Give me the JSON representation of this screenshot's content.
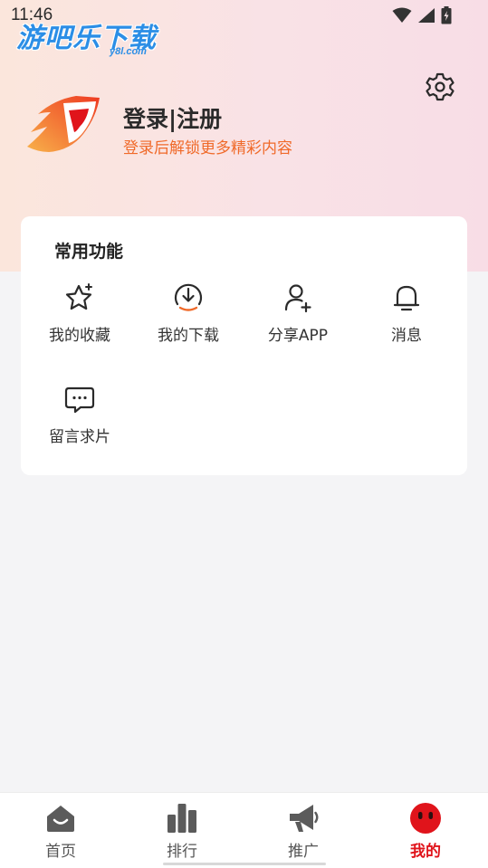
{
  "status_bar": {
    "time": "11:46"
  },
  "watermark": {
    "brand": "游吧乐下载",
    "domain": "y8l.com"
  },
  "profile": {
    "login_label": "登录|注册",
    "subtitle": "登录后解锁更多精彩内容"
  },
  "features": {
    "title": "常用功能",
    "items": [
      {
        "label": "我的收藏",
        "icon": "star-icon"
      },
      {
        "label": "我的下载",
        "icon": "download-icon"
      },
      {
        "label": "分享APP",
        "icon": "add-user-icon"
      },
      {
        "label": "消息",
        "icon": "bell-icon"
      },
      {
        "label": "留言求片",
        "icon": "message-icon"
      }
    ]
  },
  "bottom_nav": {
    "items": [
      {
        "label": "首页",
        "icon": "home-icon"
      },
      {
        "label": "排行",
        "icon": "ranking-icon"
      },
      {
        "label": "推广",
        "icon": "megaphone-icon"
      },
      {
        "label": "我的",
        "icon": "profile-face-icon",
        "active": true
      }
    ]
  },
  "colors": {
    "accent": "#e0141b",
    "subtitle_orange": "#f06a2a",
    "watermark_blue": "#2b8ee6"
  }
}
